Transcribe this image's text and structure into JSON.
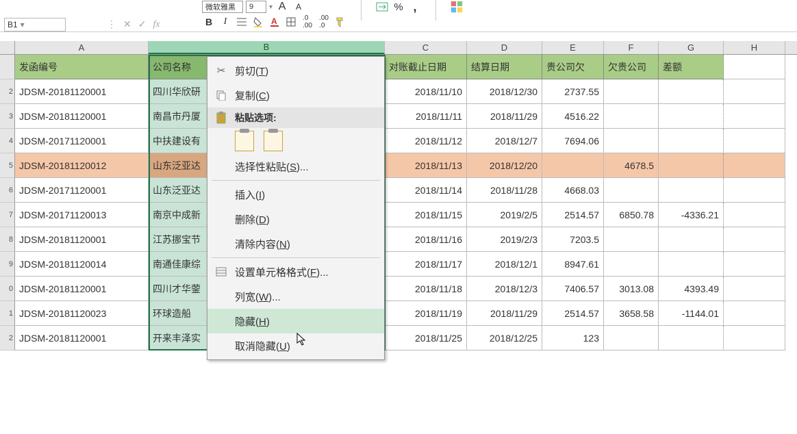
{
  "toolbar": {
    "font_name": "微软雅黑",
    "font_size": "9",
    "increase_font": "A",
    "decrease_font": "A",
    "bold": "B",
    "italic": "I"
  },
  "namebox": {
    "ref": "B1"
  },
  "columns": {
    "A": "A",
    "B": "B",
    "C": "C",
    "D": "D",
    "E": "E",
    "F": "F",
    "G": "G",
    "H": "H"
  },
  "header": {
    "a": "发函编号",
    "b": "公司名称",
    "c": "对账截止日期",
    "d": "结算日期",
    "e": "贵公司欠",
    "f": "欠贵公司",
    "g": "差额"
  },
  "rows": [
    {
      "a": "JDSM-20181120001",
      "b": "四川华欣研",
      "c": "2018/11/10",
      "d": "2018/12/30",
      "e": "2737.55",
      "f": "",
      "g": ""
    },
    {
      "a": "JDSM-20181120001",
      "b": "南昌市丹厦",
      "c": "2018/11/11",
      "d": "2018/11/29",
      "e": "4516.22",
      "f": "",
      "g": ""
    },
    {
      "a": "JDSM-20171120001",
      "b": "中扶建设有",
      "c": "2018/11/12",
      "d": "2018/12/7",
      "e": "7694.06",
      "f": "",
      "g": ""
    },
    {
      "a": "JDSM-20181120012",
      "b": "山东泛亚达",
      "c": "2018/11/13",
      "d": "2018/12/20",
      "e": "",
      "f": "4678.5",
      "g": "",
      "hl": true
    },
    {
      "a": "JDSM-20171120001",
      "b": "山东泛亚达",
      "c": "2018/11/14",
      "d": "2018/11/28",
      "e": "4668.03",
      "f": "",
      "g": ""
    },
    {
      "a": "JDSM-20171120013",
      "b": "南京中成新",
      "c": "2018/11/15",
      "d": "2019/2/5",
      "e": "2514.57",
      "f": "6850.78",
      "g": "-4336.21"
    },
    {
      "a": "JDSM-20181120001",
      "b": "江苏挪宝节",
      "c": "2018/11/16",
      "d": "2019/2/3",
      "e": "7203.5",
      "f": "",
      "g": ""
    },
    {
      "a": "JDSM-20181120014",
      "b": "南通佳康综",
      "c": "2018/11/17",
      "d": "2018/12/1",
      "e": "8947.61",
      "f": "",
      "g": ""
    },
    {
      "a": "JDSM-20181120001",
      "b": "四川才华蓥",
      "c": "2018/11/18",
      "d": "2018/12/3",
      "e": "7406.57",
      "f": "3013.08",
      "g": "4393.49"
    },
    {
      "a": "JDSM-20181120023",
      "b": "环球造船",
      "c": "2018/11/19",
      "d": "2018/11/29",
      "e": "2514.57",
      "f": "3658.58",
      "g": "-1144.01"
    },
    {
      "a": "JDSM-20181120001",
      "b": "开来丰泽实",
      "c": "2018/11/25",
      "d": "2018/12/25",
      "e": "123",
      "f": "",
      "g": ""
    }
  ],
  "row_labels": [
    "",
    "2",
    "3",
    "4",
    "5",
    "6",
    "7",
    "8",
    "9",
    "0",
    "1",
    "2"
  ],
  "context_menu": {
    "cut": "剪切(T)",
    "copy": "复制(C)",
    "paste_options": "粘贴选项:",
    "paste_special": "选择性粘贴(S)...",
    "insert": "插入(I)",
    "delete": "删除(D)",
    "clear": "清除内容(N)",
    "format": "设置单元格格式(F)...",
    "col_width": "列宽(W)...",
    "hide": "隐藏(H)",
    "unhide": "取消隐藏(U)"
  }
}
